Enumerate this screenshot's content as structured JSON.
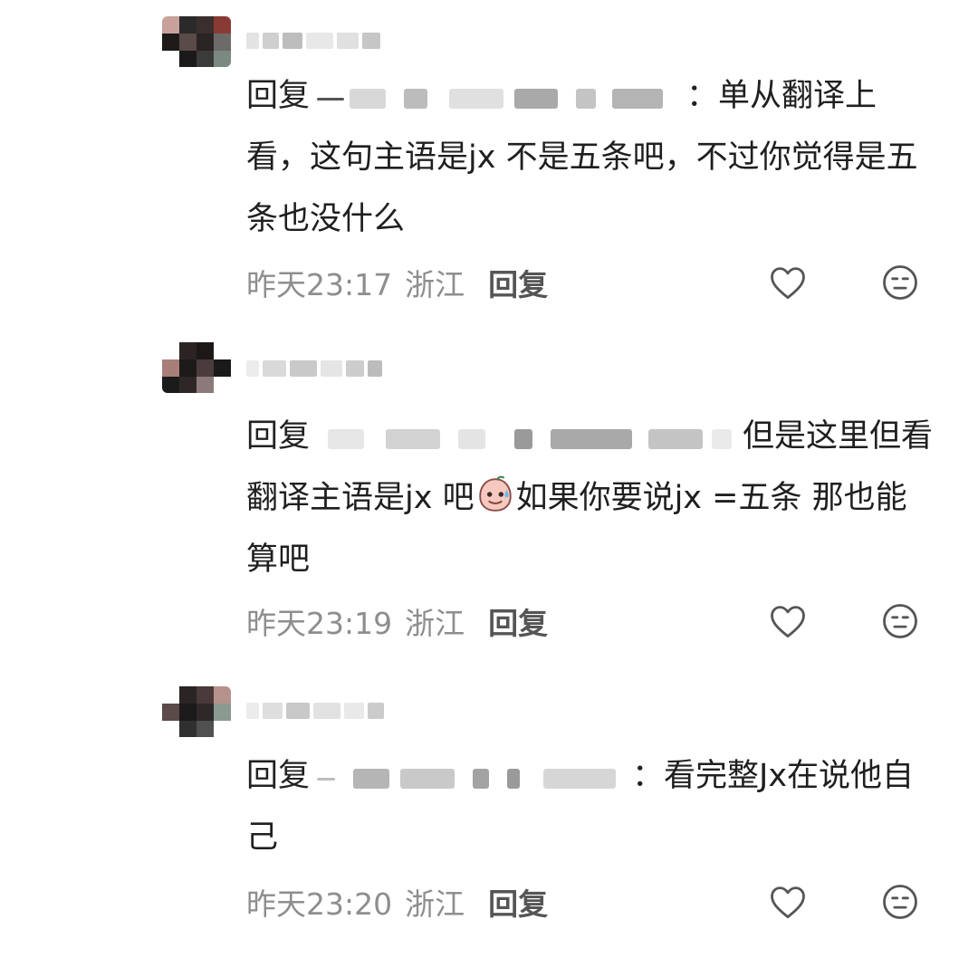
{
  "reply_word": "回复",
  "comments": [
    {
      "body_after_mask": "：单从翻译上看，这句主语是jx 不是五条吧，不过你觉得是五条也没什么",
      "time": "昨天23:17",
      "location": "浙江",
      "reply_label": "回复",
      "like_icon": "heart-outline-icon",
      "dislike_icon": "meh-face-icon"
    },
    {
      "body_before_emoji": "但是这里但看翻译主语是jx 吧",
      "emoji": "sweat-smile-emoji",
      "body_after_emoji": "如果你要说jx =五条 那也能算吧",
      "time": "昨天23:19",
      "location": "浙江",
      "reply_label": "回复",
      "like_icon": "heart-outline-icon",
      "dislike_icon": "meh-face-icon"
    },
    {
      "body_after_mask": "：看完整Jx在说他自己",
      "time": "昨天23:20",
      "location": "浙江",
      "reply_label": "回复",
      "like_icon": "heart-outline-icon",
      "dislike_icon": "meh-face-icon"
    }
  ],
  "colors": {
    "text": "#1f1f1f",
    "meta_text": "#8e8e8e",
    "icon_stroke": "#555555",
    "background": "#ffffff"
  }
}
